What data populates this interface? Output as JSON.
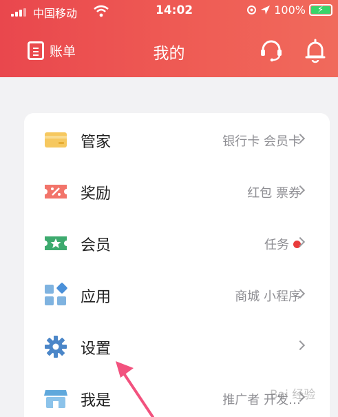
{
  "status_bar": {
    "carrier": "中国移动",
    "time": "14:02",
    "battery": "100%"
  },
  "nav": {
    "bill_label": "账单",
    "title": "我的"
  },
  "menu": [
    {
      "label": "管家",
      "sub": "银行卡 会员卡",
      "icon": "card-icon"
    },
    {
      "label": "奖励",
      "sub": "红包 票券",
      "icon": "coupon-icon"
    },
    {
      "label": "会员",
      "sub": "任务",
      "icon": "vip-ticket-icon",
      "badge_dot": true
    },
    {
      "label": "应用",
      "sub": "商城 小程序",
      "icon": "apps-grid-icon"
    },
    {
      "label": "设置",
      "sub": "",
      "icon": "gear-icon"
    },
    {
      "label": "我是",
      "sub": "推广者 开发…",
      "icon": "store-icon"
    }
  ],
  "watermark": "Bai 经验",
  "colors": {
    "header_red": "#e9474d",
    "badge_red": "#e93b3b",
    "annotation_pink": "#f2527e"
  }
}
